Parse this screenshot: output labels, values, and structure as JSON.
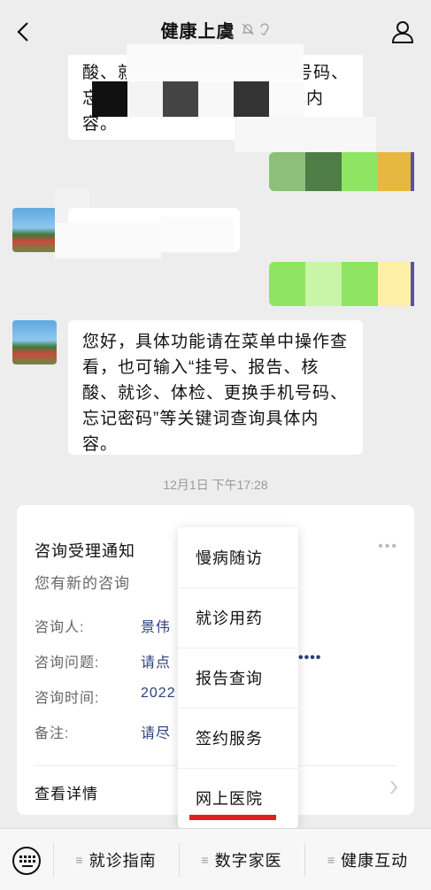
{
  "header": {
    "title": "健康上虞",
    "back_icon": "chevron-left-icon",
    "profile_icon": "person-icon"
  },
  "messages": {
    "partial_top": {
      "line1": "酸、就",
      "line1_end": "号码、",
      "line2": "忘",
      "line2_end": "体内",
      "line3": "容。"
    },
    "partial_mid": "",
    "bot_message": {
      "lines": [
        "您好，具体功能请在菜单中操作查",
        "看，也可输入“挂号、报告、核",
        "酸、就诊、体检、更换手机号码、",
        "忘记密码”等关键词查询具体内",
        "容。"
      ]
    },
    "timestamp": "12月1日 下午17:28"
  },
  "card": {
    "title": "咨询受理通知",
    "subtitle": "您有新的咨询",
    "more": "•••",
    "rows": [
      {
        "label": "咨询人:",
        "value": "景伟"
      },
      {
        "label": "咨询问题:",
        "value": "请点"
      },
      {
        "label": "咨询时间:",
        "value": "2022"
      },
      {
        "label": "备注:",
        "value": "请尽"
      }
    ],
    "ellipsis": "••••",
    "detail": "查看详情"
  },
  "popup_menu": {
    "items": [
      "慢病随访",
      "就诊用药",
      "报告查询",
      "签约服务",
      "网上医院"
    ]
  },
  "bottom_bar": {
    "tabs": [
      "就诊指南",
      "数字家医",
      "健康互动"
    ]
  },
  "colors": {
    "background": "#ededed",
    "highlight": "#e0201f",
    "link_value": "#2b3f7a"
  }
}
